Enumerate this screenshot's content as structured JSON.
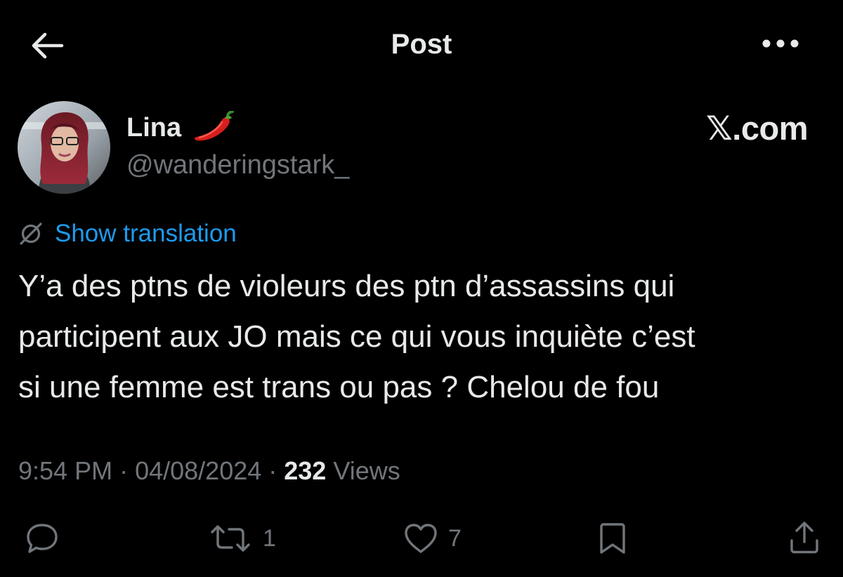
{
  "header": {
    "title": "Post",
    "back_icon": "arrow-left-icon",
    "more_icon": "more-horizontal-icon"
  },
  "author": {
    "display_name": "Lina",
    "emoji": "chili-pepper-icon",
    "handle": "@wanderingstark_"
  },
  "brand": "𝕏.com",
  "translation": {
    "icon": "translate-globe-icon",
    "label": "Show translation"
  },
  "post": {
    "line1": "Y’a des ptns de violeurs des ptn d’assassins qui",
    "line2": "participent aux JO mais ce qui vous inquiète c’est",
    "line3": "si une femme est trans ou pas ? Chelou de fou"
  },
  "meta": {
    "time": "9:54 PM",
    "separator": " · ",
    "date": "04/08/2024",
    "views_count": "232",
    "views_label": "Views"
  },
  "actions": {
    "reply": {
      "icon": "reply-icon",
      "count": ""
    },
    "repost": {
      "icon": "repost-icon",
      "count": "1"
    },
    "like": {
      "icon": "heart-icon",
      "count": "7"
    },
    "bookmark": {
      "icon": "bookmark-icon",
      "count": ""
    },
    "share": {
      "icon": "share-icon",
      "count": ""
    }
  },
  "colors": {
    "background": "#000000",
    "text": "#e7e9ea",
    "muted": "#71767b",
    "link": "#1d9bf0"
  }
}
